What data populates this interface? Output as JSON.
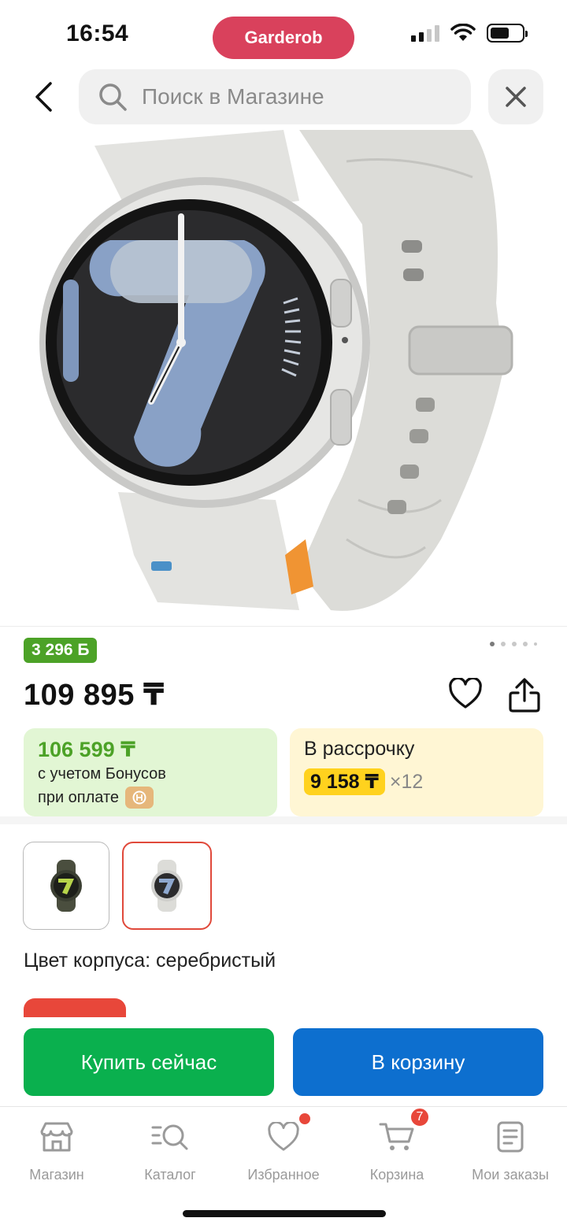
{
  "status_bar": {
    "time": "16:54",
    "app_name": "Garderob"
  },
  "search": {
    "placeholder": "Поиск в Магазине"
  },
  "product": {
    "bonus_badge": "3 296 Б",
    "price": "109 895 ₸",
    "image_count": 5,
    "image_active_index": 0
  },
  "bonus_card": {
    "amount": "106 599 ₸",
    "line1": "с учетом Бонусов",
    "line2": "при оплате"
  },
  "installment_card": {
    "title": "В рассрочку",
    "monthly": "9 158 ₸",
    "multiplier": "×12"
  },
  "variants": {
    "selected_index": 1,
    "color_label": "Цвет корпуса: серебристый"
  },
  "actions": {
    "buy_now": "Купить сейчас",
    "add_to_cart": "В корзину"
  },
  "tabbar": {
    "items": [
      {
        "label": "Магазин",
        "icon": "store-icon"
      },
      {
        "label": "Каталог",
        "icon": "catalog-search-icon"
      },
      {
        "label": "Избранное",
        "icon": "heart-icon"
      },
      {
        "label": "Корзина",
        "icon": "cart-icon",
        "badge": "7"
      },
      {
        "label": "Мои заказы",
        "icon": "orders-icon"
      }
    ]
  },
  "colors": {
    "app_pill": "#d9415c",
    "bonus_green": "#4ca227",
    "buy_button": "#0ab04e",
    "cart_button": "#0d6fcf",
    "installment_highlight": "#ffd21e",
    "badge_red": "#e8473a"
  }
}
